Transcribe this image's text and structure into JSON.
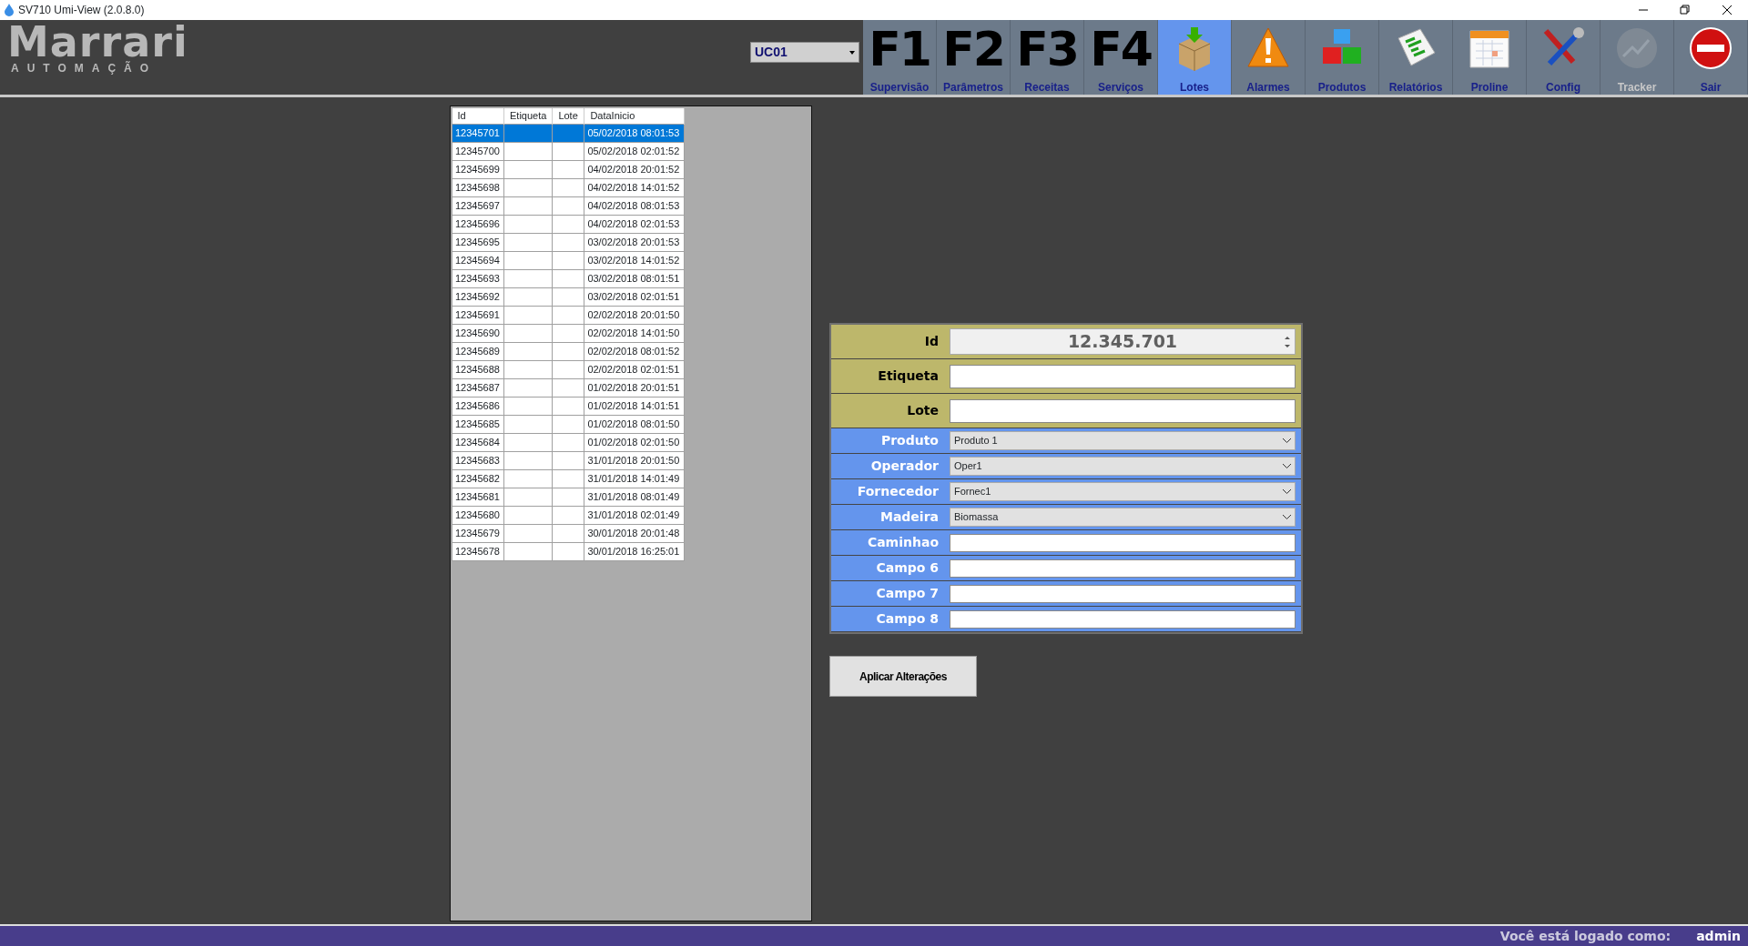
{
  "window": {
    "title": "SV710 Umi-View (2.0.8.0)"
  },
  "logo": {
    "name": "Marrari",
    "tagline": "AUTOMAÇÃO"
  },
  "unit_select": {
    "value": "UC01"
  },
  "toolbar": [
    {
      "kind": "key",
      "key": "F1",
      "label": "Supervisão",
      "selected": false,
      "disabled": false
    },
    {
      "kind": "key",
      "key": "F2",
      "label": "Parâmetros",
      "selected": false,
      "disabled": false
    },
    {
      "kind": "key",
      "key": "F3",
      "label": "Receitas",
      "selected": false,
      "disabled": false
    },
    {
      "kind": "key",
      "key": "F4",
      "label": "Serviços",
      "selected": false,
      "disabled": false
    },
    {
      "kind": "box",
      "label": "Lotes",
      "selected": true,
      "disabled": false
    },
    {
      "kind": "alarm",
      "label": "Alarmes",
      "selected": false,
      "disabled": false
    },
    {
      "kind": "cubes",
      "label": "Produtos",
      "selected": false,
      "disabled": false
    },
    {
      "kind": "report",
      "label": "Relatórios",
      "selected": false,
      "disabled": false
    },
    {
      "kind": "calendar",
      "label": "Proline",
      "selected": false,
      "disabled": false
    },
    {
      "kind": "tools",
      "label": "Config",
      "selected": false,
      "disabled": false
    },
    {
      "kind": "chart",
      "label": "Tracker",
      "selected": false,
      "disabled": true
    },
    {
      "kind": "stop",
      "label": "Sair",
      "selected": false,
      "disabled": false
    }
  ],
  "lots_table": {
    "columns": [
      "Id",
      "Etiqueta",
      "Lote",
      "DataInicio"
    ],
    "rows": [
      {
        "id": "12345701",
        "data_inicio": "05/02/2018 08:01:53",
        "selected": true
      },
      {
        "id": "12345700",
        "data_inicio": "05/02/2018 02:01:52",
        "selected": false
      },
      {
        "id": "12345699",
        "data_inicio": "04/02/2018 20:01:52",
        "selected": false
      },
      {
        "id": "12345698",
        "data_inicio": "04/02/2018 14:01:52",
        "selected": false
      },
      {
        "id": "12345697",
        "data_inicio": "04/02/2018 08:01:53",
        "selected": false
      },
      {
        "id": "12345696",
        "data_inicio": "04/02/2018 02:01:53",
        "selected": false
      },
      {
        "id": "12345695",
        "data_inicio": "03/02/2018 20:01:53",
        "selected": false
      },
      {
        "id": "12345694",
        "data_inicio": "03/02/2018 14:01:52",
        "selected": false
      },
      {
        "id": "12345693",
        "data_inicio": "03/02/2018 08:01:51",
        "selected": false
      },
      {
        "id": "12345692",
        "data_inicio": "03/02/2018 02:01:51",
        "selected": false
      },
      {
        "id": "12345691",
        "data_inicio": "02/02/2018 20:01:50",
        "selected": false
      },
      {
        "id": "12345690",
        "data_inicio": "02/02/2018 14:01:50",
        "selected": false
      },
      {
        "id": "12345689",
        "data_inicio": "02/02/2018 08:01:52",
        "selected": false
      },
      {
        "id": "12345688",
        "data_inicio": "02/02/2018 02:01:51",
        "selected": false
      },
      {
        "id": "12345687",
        "data_inicio": "01/02/2018 20:01:51",
        "selected": false
      },
      {
        "id": "12345686",
        "data_inicio": "01/02/2018 14:01:51",
        "selected": false
      },
      {
        "id": "12345685",
        "data_inicio": "01/02/2018 08:01:50",
        "selected": false
      },
      {
        "id": "12345684",
        "data_inicio": "01/02/2018 02:01:50",
        "selected": false
      },
      {
        "id": "12345683",
        "data_inicio": "31/01/2018 20:01:50",
        "selected": false
      },
      {
        "id": "12345682",
        "data_inicio": "31/01/2018 14:01:49",
        "selected": false
      },
      {
        "id": "12345681",
        "data_inicio": "31/01/2018 08:01:49",
        "selected": false
      },
      {
        "id": "12345680",
        "data_inicio": "31/01/2018 02:01:49",
        "selected": false
      },
      {
        "id": "12345679",
        "data_inicio": "30/01/2018 20:01:48",
        "selected": false
      },
      {
        "id": "12345678",
        "data_inicio": "30/01/2018 16:25:01",
        "selected": false
      }
    ]
  },
  "form": {
    "fields": [
      {
        "label": "Id",
        "kind": "spin",
        "value": "12.345.701",
        "color": "#bdb76b"
      },
      {
        "label": "Etiqueta",
        "kind": "text",
        "color": "#bdb76b"
      },
      {
        "label": "Lote",
        "kind": "text",
        "color": "#bdb76b"
      },
      {
        "label": "Produto",
        "kind": "select",
        "value": "Produto 1",
        "color": "#6495ed"
      },
      {
        "label": "Operador",
        "kind": "select",
        "value": "Oper1",
        "color": "#6495ed"
      },
      {
        "label": "Fornecedor",
        "kind": "select",
        "value": "Fornec1",
        "color": "#6495ed"
      },
      {
        "label": "Madeira",
        "kind": "select",
        "value": "Biomassa",
        "color": "#6495ed"
      },
      {
        "label": "Caminhao",
        "kind": "text",
        "color": "#6495ed"
      },
      {
        "label": "Campo 6",
        "kind": "text",
        "color": "#6495ed"
      },
      {
        "label": "Campo 7",
        "kind": "text",
        "color": "#6495ed"
      },
      {
        "label": "Campo 8",
        "kind": "text",
        "color": "#6495ed"
      }
    ]
  },
  "apply_button": {
    "label": "Aplicar Alterações"
  },
  "status_bar": {
    "label": "Você está logado como:",
    "user": "admin"
  }
}
